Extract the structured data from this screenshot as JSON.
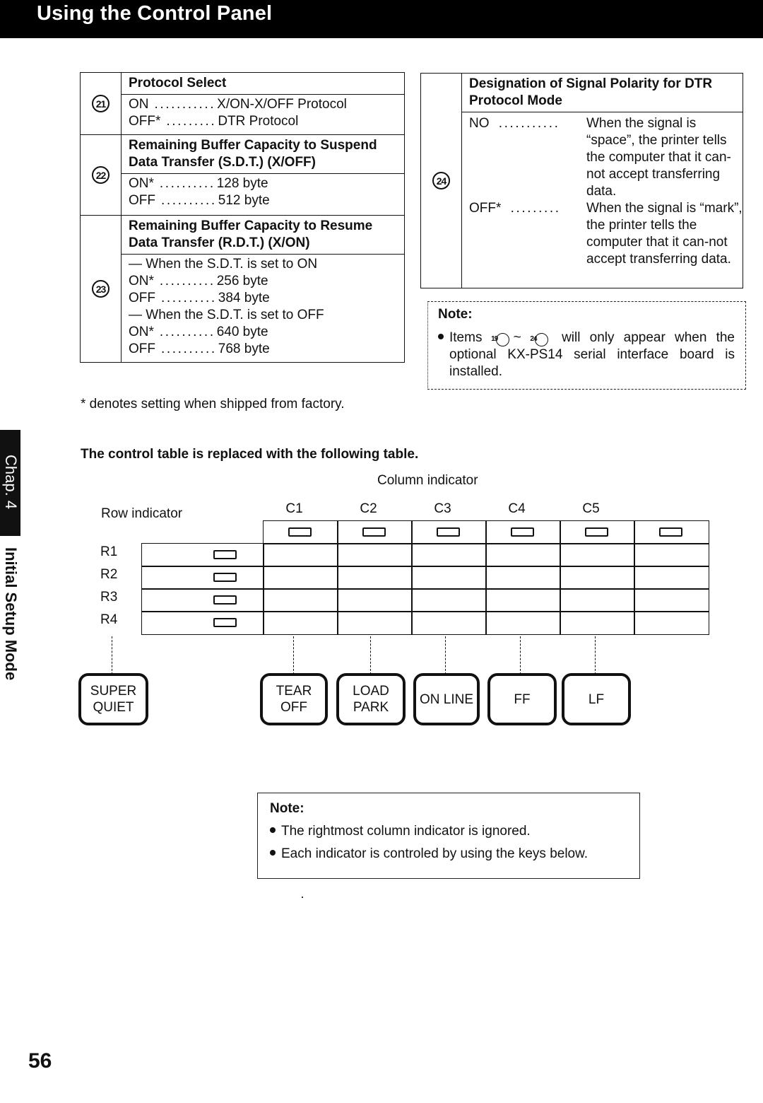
{
  "header": {
    "title": "Using the Control Panel"
  },
  "side_tab": {
    "chapter": "Chap. 4",
    "section": "Initial Setup Mode"
  },
  "left_table": [
    {
      "number": "21",
      "heading": "Protocol Select",
      "options": [
        {
          "key": "ON",
          "dots": "...........",
          "value": "X/ON-X/OFF Protocol"
        },
        {
          "key": "OFF*",
          "dots": ".........",
          "value": "DTR Protocol"
        }
      ]
    },
    {
      "number": "22",
      "heading": "Remaining Buffer Capacity to Suspend Data Transfer (S.D.T.) (X/OFF)",
      "options": [
        {
          "key": "ON*",
          "dots": "..........",
          "value": "128 byte"
        },
        {
          "key": "OFF",
          "dots": "..........",
          "value": "512 byte"
        }
      ]
    },
    {
      "number": "23",
      "heading": "Remaining Buffer Capacity to Resume Data Transfer (R.D.T.) (X/ON)",
      "groups": [
        {
          "condition": "— When the S.D.T. is set to ON",
          "options": [
            {
              "key": "ON*",
              "dots": "..........",
              "value": "256 byte"
            },
            {
              "key": "OFF",
              "dots": "..........",
              "value": "384 byte"
            }
          ]
        },
        {
          "condition": "— When the S.D.T. is set to OFF",
          "options": [
            {
              "key": "ON*",
              "dots": "..........",
              "value": "640 byte"
            },
            {
              "key": "OFF",
              "dots": "..........",
              "value": "768 byte"
            }
          ]
        }
      ]
    }
  ],
  "right_table": {
    "number": "24",
    "heading": "Designation of Signal Polarity for DTR Protocol Mode",
    "options": [
      {
        "key": "NO",
        "dots": "...........",
        "value": "When the signal is “space”, the printer tells the computer that it can-not accept transferring data."
      },
      {
        "key": "OFF*",
        "dots": ".........",
        "value": "When the signal is “mark”, the printer tells the computer that it can-not accept transferring data."
      }
    ]
  },
  "note1": {
    "title": "Note:",
    "text_before": "Items",
    "from_item": "19",
    "range_sep": "~",
    "to_item": "24",
    "text_after": "will only appear when the optional KX-PS14 serial interface board is installed."
  },
  "footnote": "*  denotes setting when shipped from factory.",
  "subheading": "The control table is replaced with the following table.",
  "control_table": {
    "column_indicator_label": "Column indicator",
    "row_indicator_label": "Row indicator",
    "columns": [
      "C1",
      "C2",
      "C3",
      "C4",
      "C5",
      ""
    ],
    "rows": [
      "R1",
      "R2",
      "R3",
      "R4"
    ]
  },
  "keys": [
    {
      "line1": "SUPER",
      "line2": "QUIET"
    },
    {
      "line1": "TEAR",
      "line2": "OFF"
    },
    {
      "line1": "LOAD",
      "line2": "PARK"
    },
    {
      "line1": "ON LINE",
      "line2": ""
    },
    {
      "line1": "FF",
      "line2": ""
    },
    {
      "line1": "LF",
      "line2": ""
    }
  ],
  "note2": {
    "title": "Note:",
    "items": [
      "The rightmost column indicator is ignored.",
      "Each indicator is controled by using the keys below."
    ]
  },
  "page_number": "56"
}
